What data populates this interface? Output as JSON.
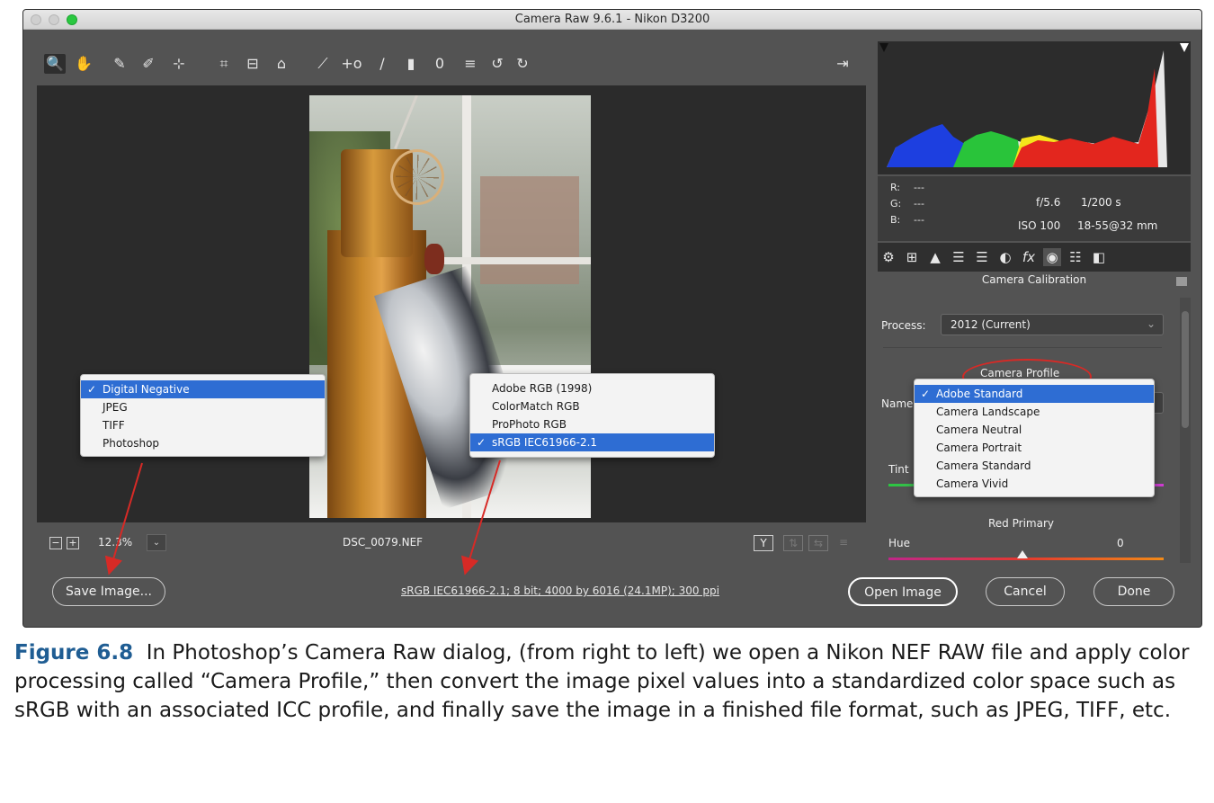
{
  "window": {
    "title": "Camera Raw 9.6.1  -  Nikon D3200"
  },
  "toolbar": {
    "tools": [
      "zoom-icon",
      "hand-icon",
      "white-balance-icon",
      "color-sampler-icon",
      "targeted-adjustment-icon",
      "crop-icon",
      "straighten-icon",
      "transform-icon",
      "spot-removal-icon",
      "red-eye-icon",
      "adjustment-brush-icon",
      "graduated-filter-icon",
      "radial-filter-icon",
      "presets-list-icon",
      "rotate-left-icon",
      "rotate-right-icon"
    ],
    "glyphs": [
      "🔍",
      "✋",
      "✎",
      "✐",
      "⊹",
      "⌗",
      "⊟",
      "⌂",
      "⟋",
      "+o",
      "/",
      "▮",
      "0",
      "≡",
      "↺",
      "↻"
    ],
    "fullscreen_glyph": "⇥"
  },
  "status": {
    "zoom_out_glyph": "−",
    "zoom_in_glyph": "+",
    "zoom": "12.3%",
    "zoom_dropdown_glyph": "⌄",
    "filename": "DSC_0079.NEF",
    "view_buttons": [
      "Y",
      "⇅",
      "⇆",
      "≡"
    ]
  },
  "histogram": {
    "colors": {
      "blue": "#1d3fe0",
      "green": "#29c43a",
      "yellow": "#f4e51b",
      "red": "#e3261e",
      "white": "#e8e8e8"
    }
  },
  "meta": {
    "r_label": "R:",
    "r_value": "---",
    "g_label": "G:",
    "g_value": "---",
    "b_label": "B:",
    "b_value": "---",
    "aperture": "f/5.6",
    "shutter": "1/200 s",
    "iso": "ISO 100",
    "lens": "18-55@32 mm"
  },
  "panel_tabs": [
    "⚙",
    "⊞",
    "▲",
    "☰",
    "☰",
    "◐",
    "fx",
    "◉",
    "☷",
    "◧"
  ],
  "panel": {
    "title": "Camera Calibration",
    "process_label": "Process:",
    "process_value": "2012 (Current)",
    "camera_profile_label": "Camera Profile",
    "name_label": "Name",
    "tint_label": "Tint",
    "red_primary_label": "Red Primary",
    "hue_label": "Hue",
    "hue_value": "0"
  },
  "menus": {
    "format": {
      "items": [
        "Digital Negative",
        "JPEG",
        "TIFF",
        "Photoshop"
      ],
      "selected": "Digital Negative"
    },
    "colorspace": {
      "items": [
        "Adobe RGB (1998)",
        "ColorMatch RGB",
        "ProPhoto RGB",
        "sRGB IEC61966-2.1"
      ],
      "selected": "sRGB IEC61966-2.1"
    },
    "profile": {
      "items": [
        "Adobe Standard",
        "Camera Landscape",
        "Camera Neutral",
        "Camera Portrait",
        "Camera Standard",
        "Camera Vivid"
      ],
      "selected": "Adobe Standard"
    },
    "check_glyph": "✓"
  },
  "buttons": {
    "save": "Save Image...",
    "open": "Open Image",
    "cancel": "Cancel",
    "done": "Done"
  },
  "workflow_info": "sRGB IEC61966-2.1; 8 bit; 4000 by 6016 (24.1MP); 300 ppi",
  "caption": {
    "figure": "Figure 6.8",
    "text": "In Photoshop’s Camera Raw dialog, (from right to left) we open a Nikon NEF RAW file and apply color processing called “Camera Profile,” then convert the image pixel values into a standardized color space such as sRGB with an associated ICC profile, and finally save the image in a finished file format, such as JPEG, TIFF, etc."
  },
  "colors": {
    "annotation_red": "#d72a26",
    "menu_highlight": "#2e6dd3",
    "caption_blue": "#1f5d93"
  }
}
